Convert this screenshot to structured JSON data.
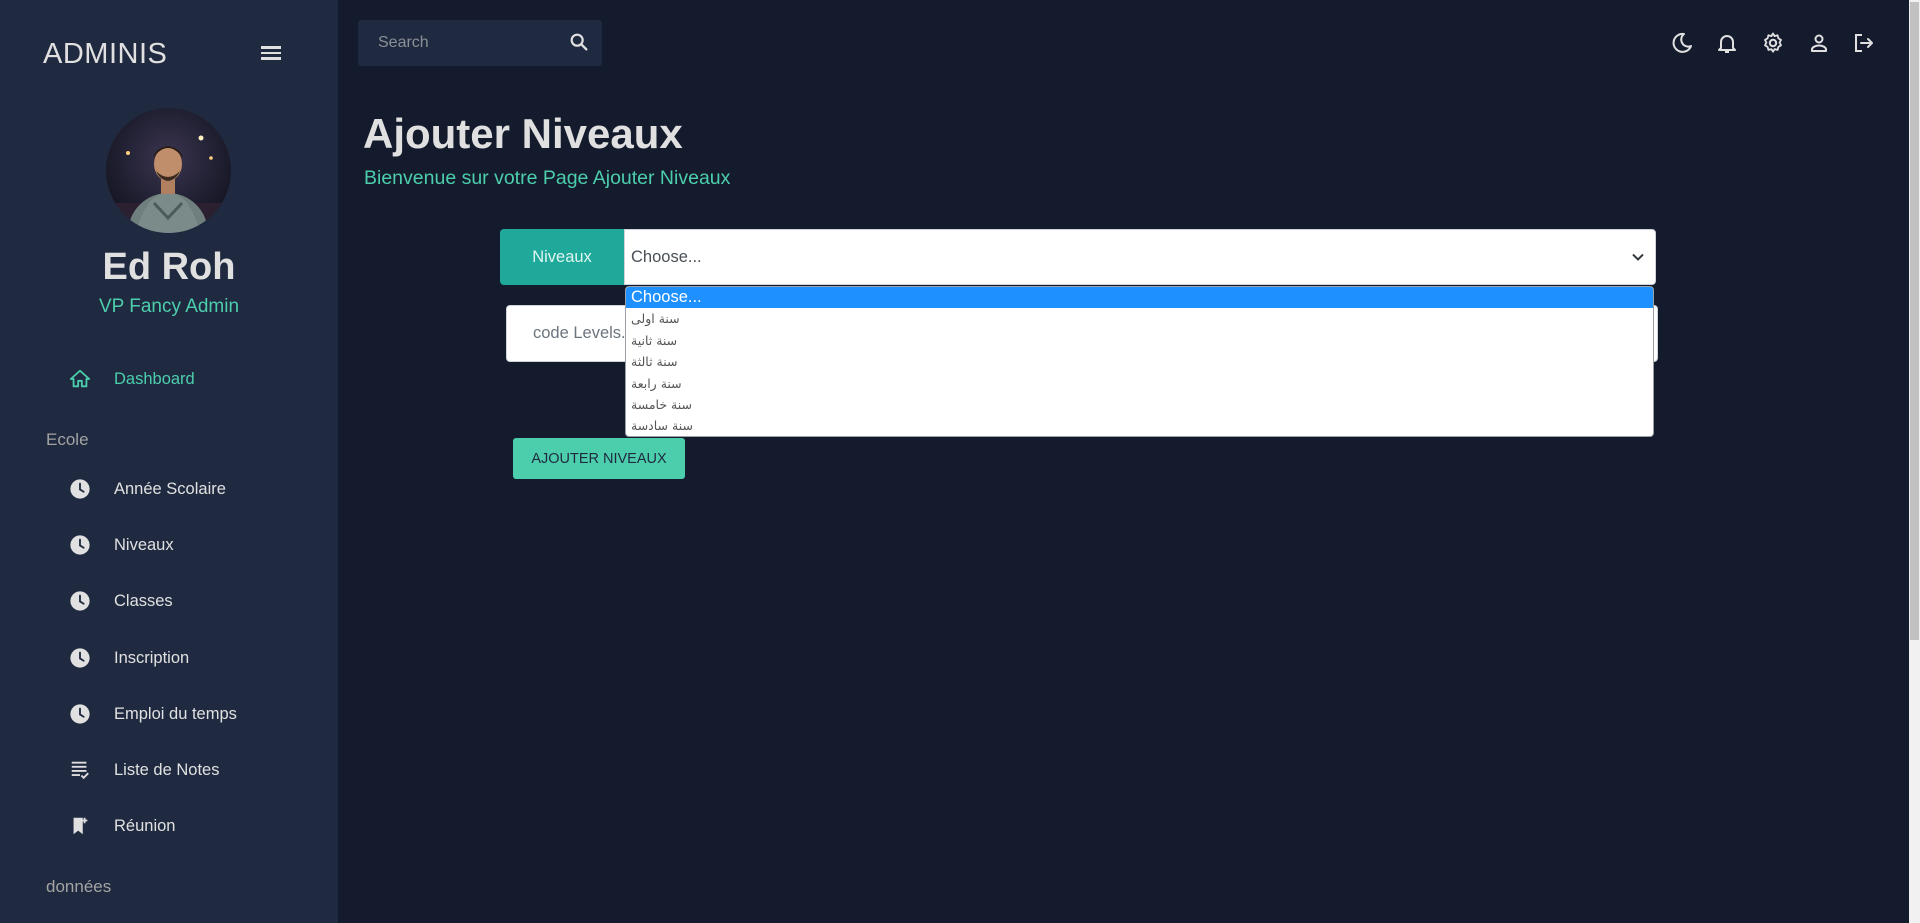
{
  "sidebar": {
    "brand": "ADMINIS",
    "profile": {
      "name": "Ed Roh",
      "role": "VP Fancy Admin"
    },
    "dashboard": {
      "label": "Dashboard",
      "icon": "home-icon"
    },
    "sections": [
      {
        "title": "Ecole",
        "items": [
          {
            "label": "Année Scolaire",
            "icon": "clock-icon"
          },
          {
            "label": "Niveaux",
            "icon": "clock-icon"
          },
          {
            "label": "Classes",
            "icon": "clock-icon"
          },
          {
            "label": "Inscription",
            "icon": "clock-icon"
          },
          {
            "label": "Emploi du temps",
            "icon": "clock-icon"
          },
          {
            "label": "Liste de Notes",
            "icon": "notes-list-icon"
          },
          {
            "label": "Réunion",
            "icon": "bookmark-add-icon"
          }
        ]
      },
      {
        "title": "données"
      }
    ]
  },
  "topbar": {
    "search": {
      "placeholder": "Search"
    },
    "icons": [
      "dark-mode-icon",
      "notifications-icon",
      "settings-icon",
      "person-icon",
      "logout-icon"
    ]
  },
  "main": {
    "title": "Ajouter Niveaux",
    "subtitle": "Bienvenue sur votre Page Ajouter Niveaux",
    "niveaux_label": "Niveaux",
    "select_value": "Choose...",
    "code_placeholder": "code Levels...",
    "dropdown_options": [
      "Choose...",
      "سنة اولى",
      "سنة ثانية",
      "سنة ثالثة",
      "سنة رابعة",
      "سنة خامسة",
      "سنة سادسة"
    ],
    "submit_label": "AJOUTER NIVEAUX"
  },
  "colors": {
    "background": "#141b2d",
    "sidebar": "#1f2a40",
    "accent": "#4cceac",
    "teal": "#1ea99a",
    "selected_option": "#1e90ff"
  }
}
